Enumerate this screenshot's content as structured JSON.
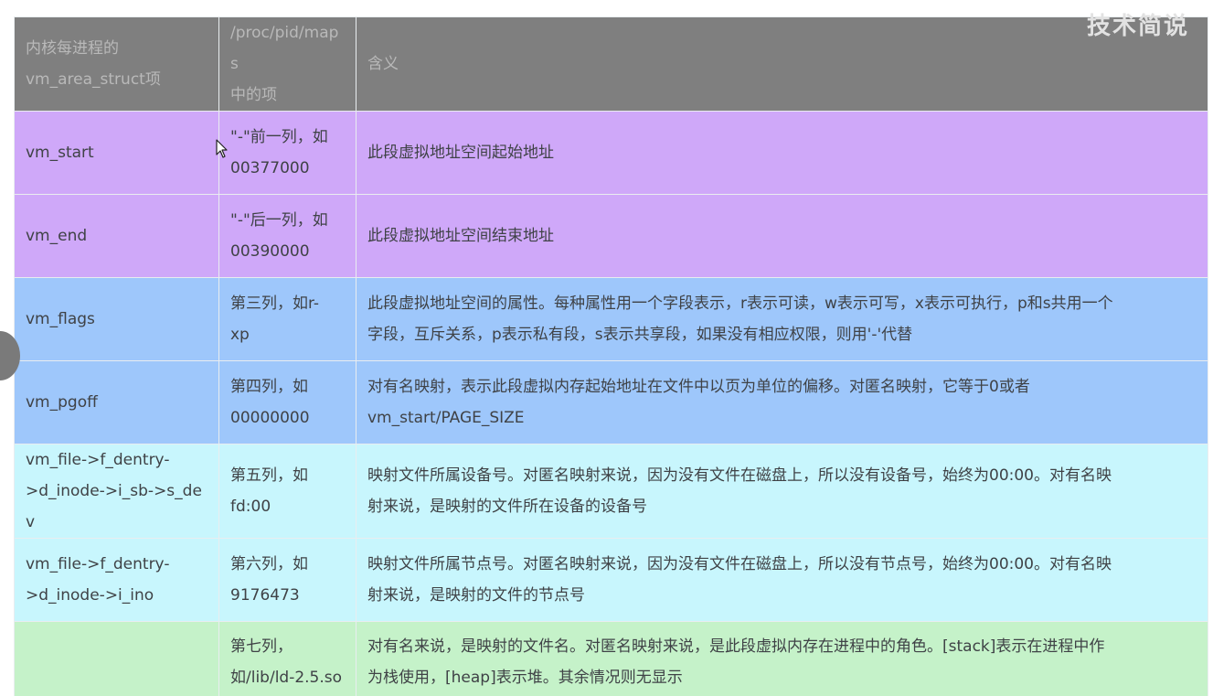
{
  "watermark": "技术简说",
  "table": {
    "headers": [
      "内核每进程的\nvm_area_struct项",
      "/proc/pid/maps\n中的项",
      "含义"
    ],
    "rows": [
      {
        "field": "vm_start",
        "maps": "\"-\"前一列，如\n00377000",
        "meaning": "此段虚拟地址空间起始地址"
      },
      {
        "field": "vm_end",
        "maps": "\"-\"后一列，如\n00390000",
        "meaning": "此段虚拟地址空间结束地址"
      },
      {
        "field": "vm_flags",
        "maps": "第三列，如r-\nxp",
        "meaning": "此段虚拟地址空间的属性。每种属性用一个字段表示，r表示可读，w表示可写，x表示可执行，p和s共用一个\n字段，互斥关系，p表示私有段，s表示共享段，如果没有相应权限，则用'-'代替"
      },
      {
        "field": "vm_pgoff",
        "maps": "第四列，如\n00000000",
        "meaning": "对有名映射，表示此段虚拟内存起始地址在文件中以页为单位的偏移。对匿名映射，它等于0或者\nvm_start/PAGE_SIZE"
      },
      {
        "field": "vm_file->f_dentry-\n>d_inode->i_sb->s_dev",
        "maps": "第五列，如\nfd:00",
        "meaning": "映射文件所属设备号。对匿名映射来说，因为没有文件在磁盘上，所以没有设备号，始终为00:00。对有名映\n射来说，是映射的文件所在设备的设备号"
      },
      {
        "field": "vm_file->f_dentry-\n>d_inode->i_ino",
        "maps": "第六列，如\n9176473",
        "meaning": "映射文件所属节点号。对匿名映射来说，因为没有文件在磁盘上，所以没有节点号，始终为00:00。对有名映\n射来说，是映射的文件的节点号"
      },
      {
        "field": "",
        "maps": "第七列，\n如/lib/ld-2.5.so",
        "meaning": "对有名来说，是映射的文件名。对匿名映射来说，是此段虚拟内存在进程中的角色。[stack]表示在进程中作\n为栈使用，[heap]表示堆。其余情况则无显示"
      }
    ]
  }
}
